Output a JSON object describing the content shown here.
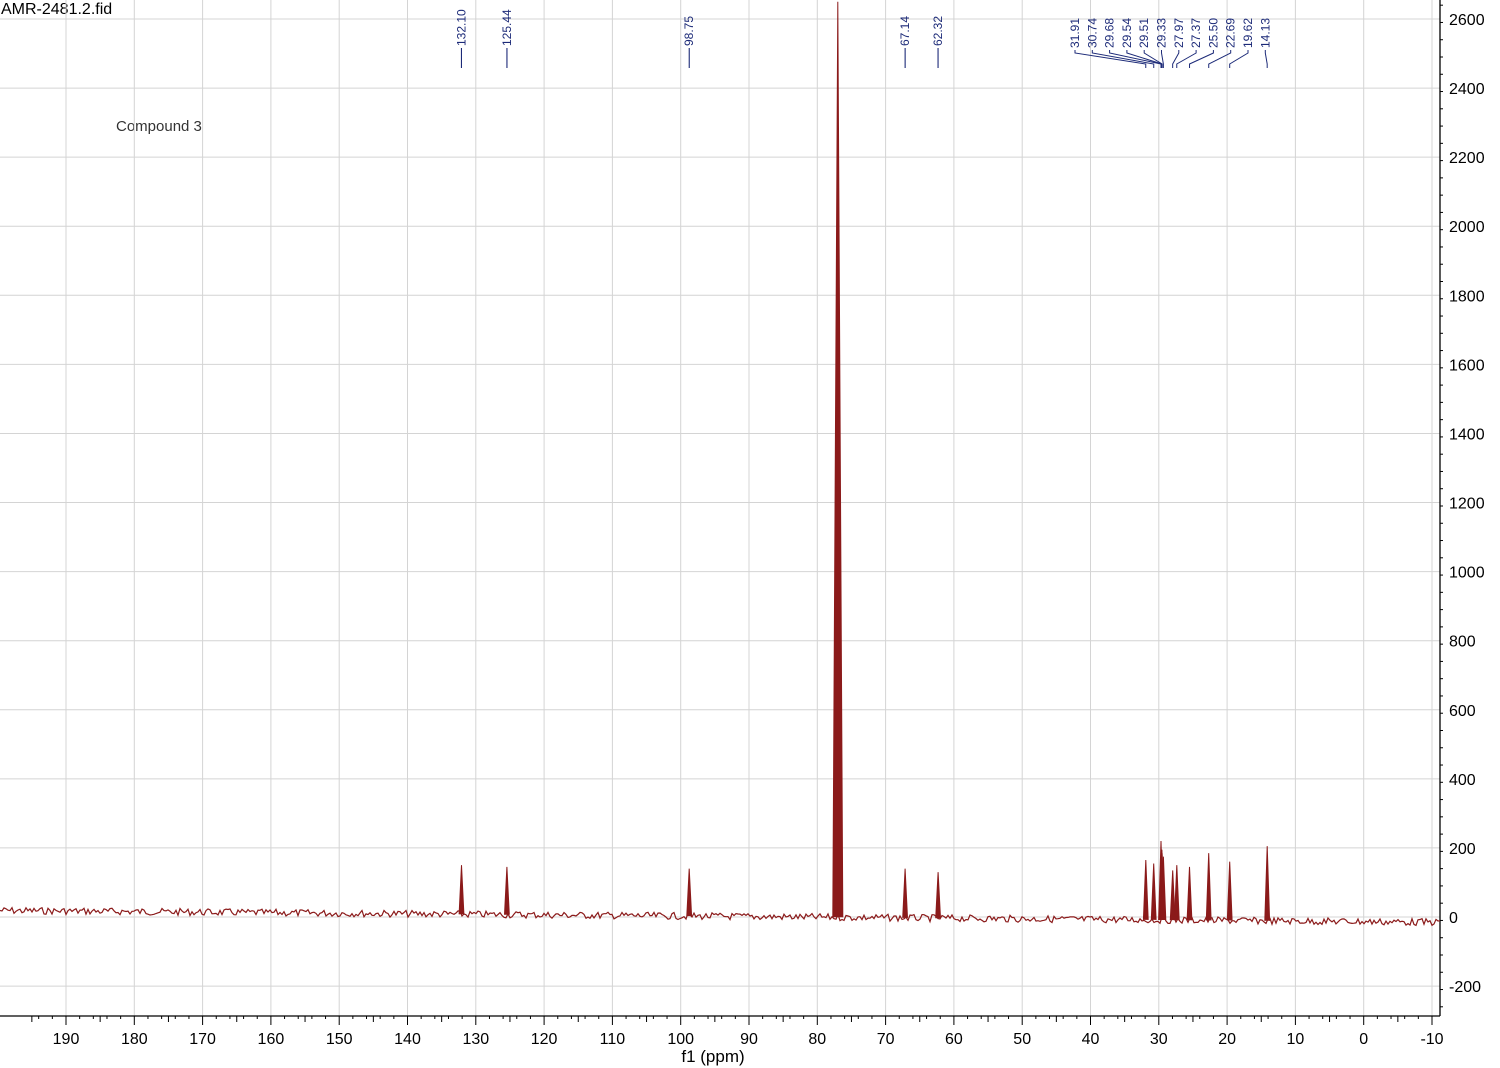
{
  "file_title": "AMR-2481.2.fid",
  "compound_label": "Compound 3",
  "colors": {
    "spectrum": "#8b1a1a",
    "peak_label": "#1c2a78",
    "grid": "#d4d4d4",
    "axis": "#000000"
  },
  "chart_data": {
    "type": "line",
    "xlabel": "f1 (ppm)",
    "ylabel": "",
    "x_reversed": true,
    "xlim": [
      195,
      -10
    ],
    "ylim": [
      -280,
      2650
    ],
    "grid": true,
    "x_ticks": [
      190,
      180,
      170,
      160,
      150,
      140,
      130,
      120,
      110,
      100,
      90,
      80,
      70,
      60,
      50,
      40,
      30,
      20,
      10,
      0,
      -10
    ],
    "x_tick_labels": [
      "190",
      "180",
      "170",
      "160",
      "150",
      "140",
      "130",
      "120",
      "110",
      "100",
      "90",
      "80",
      "70",
      "60",
      "50",
      "40",
      "30",
      "20",
      "10",
      "0",
      "-10"
    ],
    "y_ticks": [
      2600,
      2400,
      2200,
      2000,
      1800,
      1600,
      1400,
      1200,
      1000,
      800,
      600,
      400,
      200,
      0,
      -200
    ],
    "y_tick_labels": [
      "2600",
      "2400",
      "2200",
      "2000",
      "1800",
      "1600",
      "1400",
      "1200",
      "1000",
      "800",
      "600",
      "400",
      "200",
      "0",
      "-200"
    ],
    "baseline": {
      "x_start": 195,
      "y_start": 18,
      "x_end": -10,
      "y_end": -15
    },
    "peaks": [
      {
        "x": 132.1,
        "y": 150,
        "label": "132.10"
      },
      {
        "x": 125.44,
        "y": 145,
        "label": "125.44"
      },
      {
        "x": 98.75,
        "y": 140,
        "label": "98.75"
      },
      {
        "x": 77.0,
        "y": 2650,
        "label": ""
      },
      {
        "x": 67.14,
        "y": 140,
        "label": "67.14"
      },
      {
        "x": 62.32,
        "y": 130,
        "label": "62.32"
      },
      {
        "x": 31.91,
        "y": 165,
        "label": "31.91"
      },
      {
        "x": 30.74,
        "y": 155,
        "label": "30.74"
      },
      {
        "x": 29.68,
        "y": 220,
        "label": "29.68"
      },
      {
        "x": 29.54,
        "y": 195,
        "label": "29.54"
      },
      {
        "x": 29.51,
        "y": 185,
        "label": "29.51"
      },
      {
        "x": 29.33,
        "y": 175,
        "label": "29.33"
      },
      {
        "x": 27.97,
        "y": 135,
        "label": "27.97"
      },
      {
        "x": 27.37,
        "y": 150,
        "label": "27.37"
      },
      {
        "x": 25.5,
        "y": 145,
        "label": "25.50"
      },
      {
        "x": 22.69,
        "y": 185,
        "label": "22.69"
      },
      {
        "x": 19.62,
        "y": 160,
        "label": "19.62"
      },
      {
        "x": 14.13,
        "y": 205,
        "label": "14.13"
      }
    ]
  }
}
